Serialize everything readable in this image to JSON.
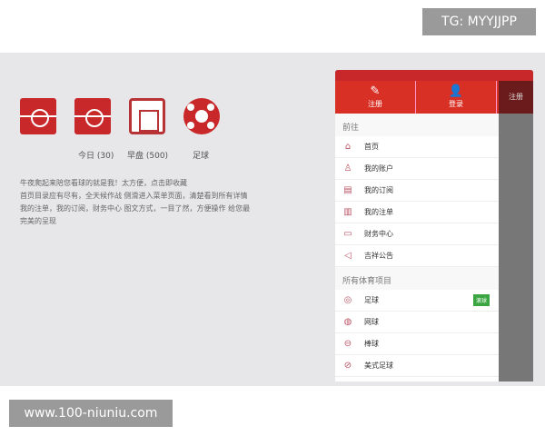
{
  "watermark_top": "TG: MYYJJPP",
  "watermark_bottom": "www.100-niuniu.com",
  "feature_icons": [
    "live-field-icon",
    "clock-field-icon",
    "calendar-field-icon",
    "soccer-ball-icon"
  ],
  "feature_labels": [
    "今日 (30)",
    "早盘 (500)",
    "足球"
  ],
  "description": [
    "牛夜爬起来陪您看球的就是我！太方便，点击即收藏",
    "首页目录应有尽有，全天候作战 侧滑进入菜单页面，清楚看到所有详情",
    "我的注单，我的订阅，财务中心 图文方式，一目了然，方便操作 给您最完美的呈现"
  ],
  "phone": {
    "header": {
      "register": "注册",
      "login": "登录",
      "side": "注册"
    },
    "section1": "前往",
    "nav": [
      {
        "label": "首页",
        "icon": "home"
      },
      {
        "label": "我的账户",
        "icon": "user"
      },
      {
        "label": "我的订阅",
        "icon": "doc"
      },
      {
        "label": "我的注单",
        "icon": "ticket"
      },
      {
        "label": "财务中心",
        "icon": "wallet"
      },
      {
        "label": "吉祥公告",
        "icon": "speaker"
      }
    ],
    "section2": "所有体育项目",
    "sports": [
      {
        "label": "足球",
        "badge": "滚球"
      },
      {
        "label": "网球"
      },
      {
        "label": "棒球"
      },
      {
        "label": "美式足球"
      }
    ]
  },
  "colors": {
    "brand": "#d93026",
    "badge": "#3aa541"
  }
}
